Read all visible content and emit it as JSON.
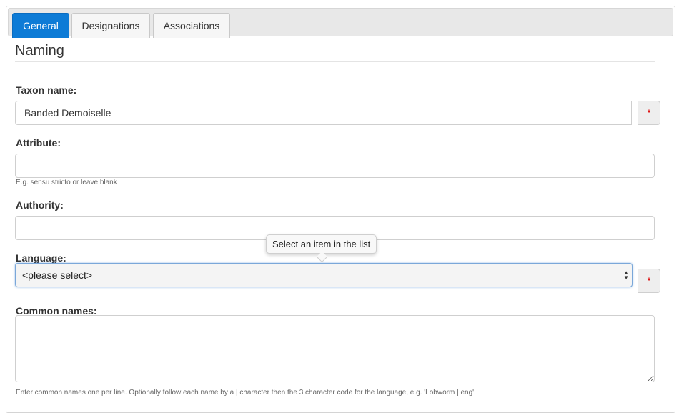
{
  "tabs": [
    {
      "label": "General",
      "active": true
    },
    {
      "label": "Designations",
      "active": false
    },
    {
      "label": "Associations",
      "active": false
    }
  ],
  "section": {
    "title": "Naming"
  },
  "fields": {
    "taxon_name": {
      "label": "Taxon name:",
      "value": "Banded Demoiselle",
      "required_marker": "*"
    },
    "attribute": {
      "label": "Attribute:",
      "value": "",
      "help": "E.g. sensu stricto or leave blank"
    },
    "authority": {
      "label": "Authority:",
      "value": ""
    },
    "language": {
      "label": "Language:",
      "selected": "<please select>",
      "required_marker": "*",
      "tooltip": "Select an item in the list"
    },
    "common_names": {
      "label": "Common names:",
      "value": "",
      "help": "Enter common names one per line. Optionally follow each name by a | character then the 3 character code for the language, e.g. 'Lobworm | eng'."
    }
  },
  "colors": {
    "accent": "#0d7bd6",
    "required": "#dd0000"
  }
}
